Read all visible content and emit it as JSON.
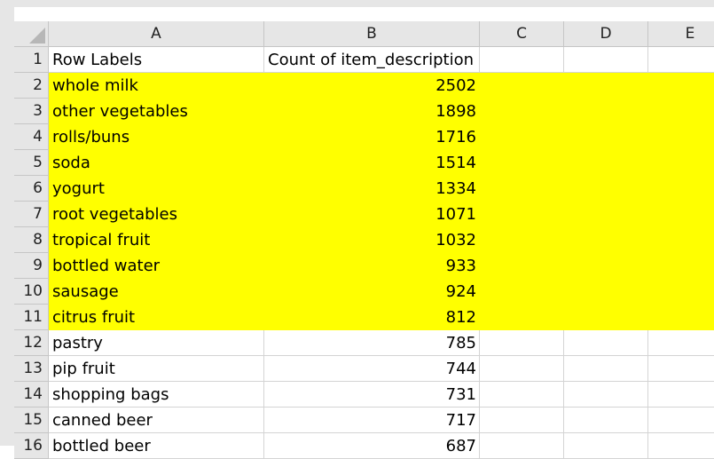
{
  "columns": [
    "A",
    "B",
    "C",
    "D",
    "E"
  ],
  "header_row": {
    "num": "1",
    "a": "Row Labels",
    "b": "Count of item_description"
  },
  "rows": [
    {
      "num": "2",
      "label": "whole milk",
      "count": "2502"
    },
    {
      "num": "3",
      "label": "other vegetables",
      "count": "1898"
    },
    {
      "num": "4",
      "label": "rolls/buns",
      "count": "1716"
    },
    {
      "num": "5",
      "label": "soda",
      "count": "1514"
    },
    {
      "num": "6",
      "label": "yogurt",
      "count": "1334"
    },
    {
      "num": "7",
      "label": "root vegetables",
      "count": "1071"
    },
    {
      "num": "8",
      "label": "tropical fruit",
      "count": "1032"
    },
    {
      "num": "9",
      "label": "bottled water",
      "count": "933"
    },
    {
      "num": "10",
      "label": "sausage",
      "count": "924"
    },
    {
      "num": "11",
      "label": "citrus fruit",
      "count": "812"
    },
    {
      "num": "12",
      "label": "pastry",
      "count": "785"
    },
    {
      "num": "13",
      "label": "pip fruit",
      "count": "744"
    },
    {
      "num": "14",
      "label": "shopping bags",
      "count": "731"
    },
    {
      "num": "15",
      "label": "canned beer",
      "count": "717"
    },
    {
      "num": "16",
      "label": "bottled beer",
      "count": "687"
    }
  ],
  "highlight_color": "#ffff00",
  "corner_icon": "select-all-triangle-icon"
}
